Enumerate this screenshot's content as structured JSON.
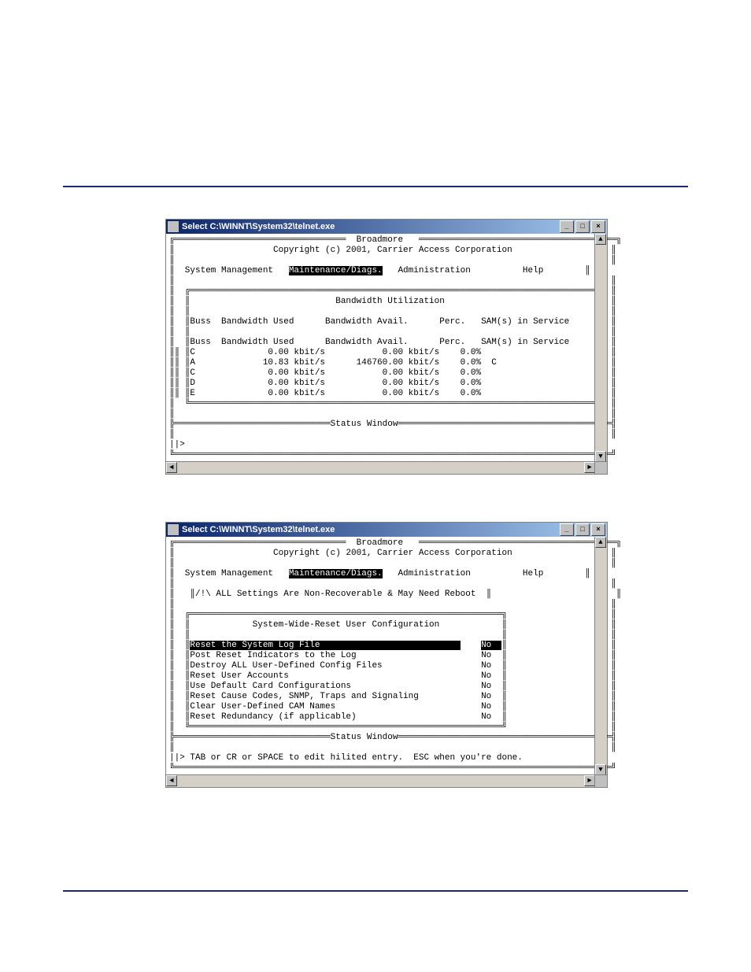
{
  "window_title": "Select C:\\WINNT\\System32\\telnet.exe",
  "titlebar_buttons": {
    "min": "_",
    "max": "□",
    "close": "×"
  },
  "scroll": {
    "up": "▲",
    "down": "▼",
    "left": "◄",
    "right": "►"
  },
  "screen1": {
    "app_name": "Broadmore",
    "copyright": "Copyright (c) 2001, Carrier Access Corporation",
    "menu": {
      "system_management": "System Management",
      "maintenance_diags": "Maintenance/Diags.",
      "administration": "Administration",
      "help": "Help"
    },
    "section_title": "Bandwidth Utilization",
    "header": {
      "buss": "Buss",
      "bw_used": "Bandwidth Used",
      "bw_avail": "Bandwidth Avail.",
      "perc": "Perc.",
      "sams": "SAM(s) in Service"
    },
    "rows": [
      {
        "buss": "C",
        "used": "0.00 kbit/s",
        "avail": "0.00 kbit/s",
        "perc": "0.0%",
        "sams": ""
      },
      {
        "buss": "A",
        "used": "10.83 kbit/s",
        "avail": "146760.00 kbit/s",
        "perc": "0.0%",
        "sams": "C"
      },
      {
        "buss": "C",
        "used": "0.00 kbit/s",
        "avail": "0.00 kbit/s",
        "perc": "0.0%",
        "sams": ""
      },
      {
        "buss": "D",
        "used": "0.00 kbit/s",
        "avail": "0.00 kbit/s",
        "perc": "0.0%",
        "sams": ""
      },
      {
        "buss": "E",
        "used": "0.00 kbit/s",
        "avail": "0.00 kbit/s",
        "perc": "0.0%",
        "sams": ""
      }
    ],
    "status_label": "Status Window",
    "prompt": "||>"
  },
  "screen2": {
    "app_name": "Broadmore",
    "copyright": "Copyright (c) 2001, Carrier Access Corporation",
    "menu": {
      "system_management": "System Management",
      "maintenance_diags": "Maintenance/Diags.",
      "administration": "Administration",
      "help": "Help"
    },
    "warning": "/!\\ ALL Settings Are Non-Recoverable & May Need Reboot",
    "section_title": "System-Wide-Reset User Configuration",
    "options": [
      {
        "label": "Reset the System Log File",
        "value": "No",
        "selected": true
      },
      {
        "label": "Post Reset Indicators to the Log",
        "value": "No",
        "selected": false
      },
      {
        "label": "Destroy ALL User-Defined Config Files",
        "value": "No",
        "selected": false
      },
      {
        "label": "Reset User Accounts",
        "value": "No",
        "selected": false
      },
      {
        "label": "Use Default Card Configurations",
        "value": "No",
        "selected": false
      },
      {
        "label": "Reset Cause Codes, SNMP, Traps and Signaling",
        "value": "No",
        "selected": false
      },
      {
        "label": "Clear User-Defined CAM Names",
        "value": "No",
        "selected": false
      },
      {
        "label": "Reset Redundancy (if applicable)",
        "value": "No",
        "selected": false
      }
    ],
    "status_label": "Status Window",
    "status_text": "||> TAB or CR or SPACE to edit hilited entry.  ESC when you're done."
  }
}
